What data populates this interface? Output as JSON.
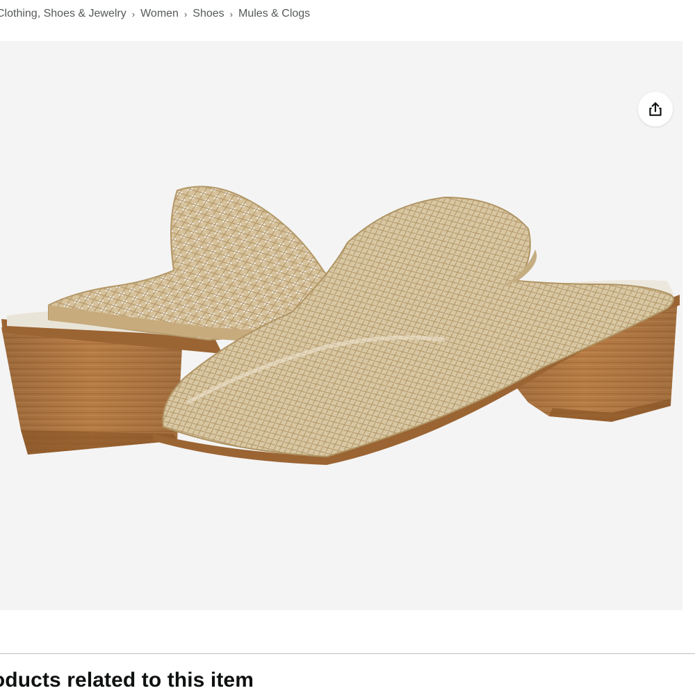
{
  "breadcrumb": {
    "items": [
      {
        "label": "Clothing, Shoes & Jewelry"
      },
      {
        "label": "Women"
      },
      {
        "label": "Shoes"
      },
      {
        "label": "Mules & Clogs"
      }
    ],
    "separator": "›"
  },
  "product_image": {
    "alt": "Woven metallic gold pointed-toe mule with stacked wood block heel",
    "background_color": "#f4f4f4"
  },
  "share_button": {
    "icon": "share-icon",
    "label": "Share"
  },
  "related_section": {
    "title": "Products related to this item"
  },
  "colors": {
    "breadcrumb_text": "#565959",
    "heading_text": "#0f1111",
    "divider": "#bbbfbf",
    "woven_upper": "#c9b28c",
    "heel_wood": "#b27a45"
  }
}
